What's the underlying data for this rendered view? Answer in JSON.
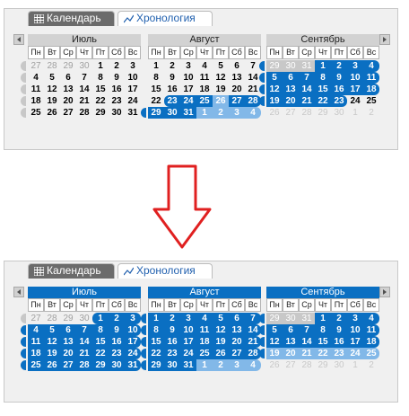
{
  "tabs": {
    "calendar": "Календарь",
    "timeline": "Хронология"
  },
  "colors": {
    "selected": "#0a6fc2",
    "selected_light": "#82b8e8",
    "gray_marker": "#c8c8c8",
    "arrow": "#e02020"
  },
  "weekdays": [
    "Пн",
    "Вт",
    "Ср",
    "Чт",
    "Пт",
    "Сб",
    "Вс"
  ],
  "before": {
    "months": [
      {
        "name": "Июль",
        "head": "gray",
        "rows": [
          [
            {
              "t": "27",
              "s": "gry"
            },
            {
              "t": "28",
              "s": "gry"
            },
            {
              "t": "29",
              "s": "gry"
            },
            {
              "t": "30",
              "s": "gry"
            },
            {
              "t": "1"
            },
            {
              "t": "2"
            },
            {
              "t": "3"
            }
          ],
          [
            {
              "t": "4"
            },
            {
              "t": "5"
            },
            {
              "t": "6"
            },
            {
              "t": "7"
            },
            {
              "t": "8"
            },
            {
              "t": "9"
            },
            {
              "t": "10"
            }
          ],
          [
            {
              "t": "11"
            },
            {
              "t": "12"
            },
            {
              "t": "13"
            },
            {
              "t": "14"
            },
            {
              "t": "15"
            },
            {
              "t": "16"
            },
            {
              "t": "17"
            }
          ],
          [
            {
              "t": "18"
            },
            {
              "t": "19"
            },
            {
              "t": "20"
            },
            {
              "t": "21"
            },
            {
              "t": "22"
            },
            {
              "t": "23"
            },
            {
              "t": "24"
            }
          ],
          [
            {
              "t": "25"
            },
            {
              "t": "26"
            },
            {
              "t": "27"
            },
            {
              "t": "28"
            },
            {
              "t": "29"
            },
            {
              "t": "30"
            },
            {
              "t": "31"
            }
          ]
        ],
        "marks": [
          "g",
          "g",
          "g",
          "g",
          "g"
        ]
      },
      {
        "name": "Август",
        "head": "gray",
        "rows": [
          [
            {
              "t": "1"
            },
            {
              "t": "2"
            },
            {
              "t": "3"
            },
            {
              "t": "4"
            },
            {
              "t": "5"
            },
            {
              "t": "6"
            },
            {
              "t": "7"
            }
          ],
          [
            {
              "t": "8"
            },
            {
              "t": "9"
            },
            {
              "t": "10"
            },
            {
              "t": "11"
            },
            {
              "t": "12"
            },
            {
              "t": "13"
            },
            {
              "t": "14"
            }
          ],
          [
            {
              "t": "15"
            },
            {
              "t": "16"
            },
            {
              "t": "17"
            },
            {
              "t": "18"
            },
            {
              "t": "19"
            },
            {
              "t": "20"
            },
            {
              "t": "21"
            }
          ],
          [
            {
              "t": "22"
            },
            {
              "t": "23",
              "s": "sel rl"
            },
            {
              "t": "24",
              "s": "sel"
            },
            {
              "t": "25",
              "s": "sel"
            },
            {
              "t": "26",
              "s": "lt"
            },
            {
              "t": "27",
              "s": "sel"
            },
            {
              "t": "28",
              "s": "sel rr"
            }
          ],
          [
            {
              "t": "29",
              "s": "sel"
            },
            {
              "t": "30",
              "s": "sel"
            },
            {
              "t": "31",
              "s": "sel"
            },
            {
              "t": "1",
              "s": "lt"
            },
            {
              "t": "2",
              "s": "lt"
            },
            {
              "t": "3",
              "s": "lt"
            },
            {
              "t": "4",
              "s": "lt rr"
            }
          ]
        ],
        "marks": [
          "",
          "",
          "",
          "",
          "b"
        ]
      },
      {
        "name": "Сентябрь",
        "head": "gray",
        "rows": [
          [
            {
              "t": "29",
              "s": "sgr"
            },
            {
              "t": "30",
              "s": "sgr"
            },
            {
              "t": "31",
              "s": "sgr"
            },
            {
              "t": "1",
              "s": "sel"
            },
            {
              "t": "2",
              "s": "sel"
            },
            {
              "t": "3",
              "s": "sel"
            },
            {
              "t": "4",
              "s": "sel rr"
            }
          ],
          [
            {
              "t": "5",
              "s": "sel"
            },
            {
              "t": "6",
              "s": "sel"
            },
            {
              "t": "7",
              "s": "sel"
            },
            {
              "t": "8",
              "s": "sel"
            },
            {
              "t": "9",
              "s": "sel"
            },
            {
              "t": "10",
              "s": "sel"
            },
            {
              "t": "11",
              "s": "sel rr"
            }
          ],
          [
            {
              "t": "12",
              "s": "sel"
            },
            {
              "t": "13",
              "s": "sel"
            },
            {
              "t": "14",
              "s": "sel"
            },
            {
              "t": "15",
              "s": "sel"
            },
            {
              "t": "16",
              "s": "sel"
            },
            {
              "t": "17",
              "s": "sel"
            },
            {
              "t": "18",
              "s": "sel rr"
            }
          ],
          [
            {
              "t": "19",
              "s": "sel"
            },
            {
              "t": "20",
              "s": "sel"
            },
            {
              "t": "21",
              "s": "sel"
            },
            {
              "t": "22",
              "s": "sel"
            },
            {
              "t": "23",
              "s": "sel rr"
            },
            {
              "t": "24"
            },
            {
              "t": "25"
            }
          ],
          [
            {
              "t": "26",
              "s": "pale"
            },
            {
              "t": "27",
              "s": "pale"
            },
            {
              "t": "28",
              "s": "pale"
            },
            {
              "t": "29",
              "s": "pale"
            },
            {
              "t": "30",
              "s": "pale"
            },
            {
              "t": "1",
              "s": "pale"
            },
            {
              "t": "2",
              "s": "pale"
            }
          ]
        ],
        "marks": [
          "b",
          "b",
          "b",
          "b",
          ""
        ]
      }
    ]
  },
  "after": {
    "months": [
      {
        "name": "Июль",
        "head": "blue",
        "rows": [
          [
            {
              "t": "27",
              "s": "gry"
            },
            {
              "t": "28",
              "s": "gry"
            },
            {
              "t": "29",
              "s": "gry"
            },
            {
              "t": "30",
              "s": "gry"
            },
            {
              "t": "1",
              "s": "sel rl"
            },
            {
              "t": "2",
              "s": "sel"
            },
            {
              "t": "3",
              "s": "sel rr"
            }
          ],
          [
            {
              "t": "4",
              "s": "sel"
            },
            {
              "t": "5",
              "s": "sel"
            },
            {
              "t": "6",
              "s": "sel"
            },
            {
              "t": "7",
              "s": "sel"
            },
            {
              "t": "8",
              "s": "sel"
            },
            {
              "t": "9",
              "s": "sel"
            },
            {
              "t": "10",
              "s": "sel rr"
            }
          ],
          [
            {
              "t": "11",
              "s": "sel"
            },
            {
              "t": "12",
              "s": "sel"
            },
            {
              "t": "13",
              "s": "sel"
            },
            {
              "t": "14",
              "s": "sel"
            },
            {
              "t": "15",
              "s": "sel"
            },
            {
              "t": "16",
              "s": "sel"
            },
            {
              "t": "17",
              "s": "sel rr"
            }
          ],
          [
            {
              "t": "18",
              "s": "sel"
            },
            {
              "t": "19",
              "s": "sel"
            },
            {
              "t": "20",
              "s": "sel"
            },
            {
              "t": "21",
              "s": "sel"
            },
            {
              "t": "22",
              "s": "sel"
            },
            {
              "t": "23",
              "s": "sel"
            },
            {
              "t": "24",
              "s": "sel rr"
            }
          ],
          [
            {
              "t": "25",
              "s": "sel"
            },
            {
              "t": "26",
              "s": "sel"
            },
            {
              "t": "27",
              "s": "sel"
            },
            {
              "t": "28",
              "s": "sel"
            },
            {
              "t": "29",
              "s": "sel"
            },
            {
              "t": "30",
              "s": "sel"
            },
            {
              "t": "31",
              "s": "sel rr"
            }
          ]
        ],
        "marks": [
          "g",
          "b",
          "b",
          "b",
          "b"
        ]
      },
      {
        "name": "Август",
        "head": "blue",
        "rows": [
          [
            {
              "t": "1",
              "s": "sel"
            },
            {
              "t": "2",
              "s": "sel"
            },
            {
              "t": "3",
              "s": "sel"
            },
            {
              "t": "4",
              "s": "sel"
            },
            {
              "t": "5",
              "s": "sel"
            },
            {
              "t": "6",
              "s": "sel"
            },
            {
              "t": "7",
              "s": "sel rr"
            }
          ],
          [
            {
              "t": "8",
              "s": "sel"
            },
            {
              "t": "9",
              "s": "sel"
            },
            {
              "t": "10",
              "s": "sel"
            },
            {
              "t": "11",
              "s": "sel"
            },
            {
              "t": "12",
              "s": "sel"
            },
            {
              "t": "13",
              "s": "sel"
            },
            {
              "t": "14",
              "s": "sel rr"
            }
          ],
          [
            {
              "t": "15",
              "s": "sel"
            },
            {
              "t": "16",
              "s": "sel"
            },
            {
              "t": "17",
              "s": "sel"
            },
            {
              "t": "18",
              "s": "sel"
            },
            {
              "t": "19",
              "s": "sel"
            },
            {
              "t": "20",
              "s": "sel"
            },
            {
              "t": "21",
              "s": "sel rr"
            }
          ],
          [
            {
              "t": "22",
              "s": "sel"
            },
            {
              "t": "23",
              "s": "sel"
            },
            {
              "t": "24",
              "s": "sel"
            },
            {
              "t": "25",
              "s": "sel"
            },
            {
              "t": "26",
              "s": "sel"
            },
            {
              "t": "27",
              "s": "sel"
            },
            {
              "t": "28",
              "s": "sel rr"
            }
          ],
          [
            {
              "t": "29",
              "s": "sel"
            },
            {
              "t": "30",
              "s": "sel"
            },
            {
              "t": "31",
              "s": "sel"
            },
            {
              "t": "1",
              "s": "lt"
            },
            {
              "t": "2",
              "s": "lt"
            },
            {
              "t": "3",
              "s": "lt"
            },
            {
              "t": "4",
              "s": "lt rr"
            }
          ]
        ],
        "marks": [
          "b",
          "b",
          "b",
          "b",
          "b"
        ]
      },
      {
        "name": "Сентябрь",
        "head": "blue",
        "rows": [
          [
            {
              "t": "29",
              "s": "sgr"
            },
            {
              "t": "30",
              "s": "sgr"
            },
            {
              "t": "31",
              "s": "sgr"
            },
            {
              "t": "1",
              "s": "sel"
            },
            {
              "t": "2",
              "s": "sel"
            },
            {
              "t": "3",
              "s": "sel"
            },
            {
              "t": "4",
              "s": "sel rr"
            }
          ],
          [
            {
              "t": "5",
              "s": "sel"
            },
            {
              "t": "6",
              "s": "sel"
            },
            {
              "t": "7",
              "s": "sel"
            },
            {
              "t": "8",
              "s": "sel"
            },
            {
              "t": "9",
              "s": "sel"
            },
            {
              "t": "10",
              "s": "sel"
            },
            {
              "t": "11",
              "s": "sel rr"
            }
          ],
          [
            {
              "t": "12",
              "s": "sel"
            },
            {
              "t": "13",
              "s": "sel"
            },
            {
              "t": "14",
              "s": "sel"
            },
            {
              "t": "15",
              "s": "sel"
            },
            {
              "t": "16",
              "s": "sel"
            },
            {
              "t": "17",
              "s": "sel"
            },
            {
              "t": "18",
              "s": "sel rr"
            }
          ],
          [
            {
              "t": "19",
              "s": "lt"
            },
            {
              "t": "20",
              "s": "lt"
            },
            {
              "t": "21",
              "s": "lt"
            },
            {
              "t": "22",
              "s": "lt"
            },
            {
              "t": "23",
              "s": "lt"
            },
            {
              "t": "24",
              "s": "lt"
            },
            {
              "t": "25",
              "s": "lt rr"
            }
          ],
          [
            {
              "t": "26",
              "s": "pale"
            },
            {
              "t": "27",
              "s": "pale"
            },
            {
              "t": "28",
              "s": "pale"
            },
            {
              "t": "29",
              "s": "pale"
            },
            {
              "t": "30",
              "s": "pale"
            },
            {
              "t": "1",
              "s": "pale"
            },
            {
              "t": "2",
              "s": "pale"
            }
          ]
        ],
        "marks": [
          "b",
          "b",
          "b",
          "b",
          ""
        ]
      }
    ]
  }
}
